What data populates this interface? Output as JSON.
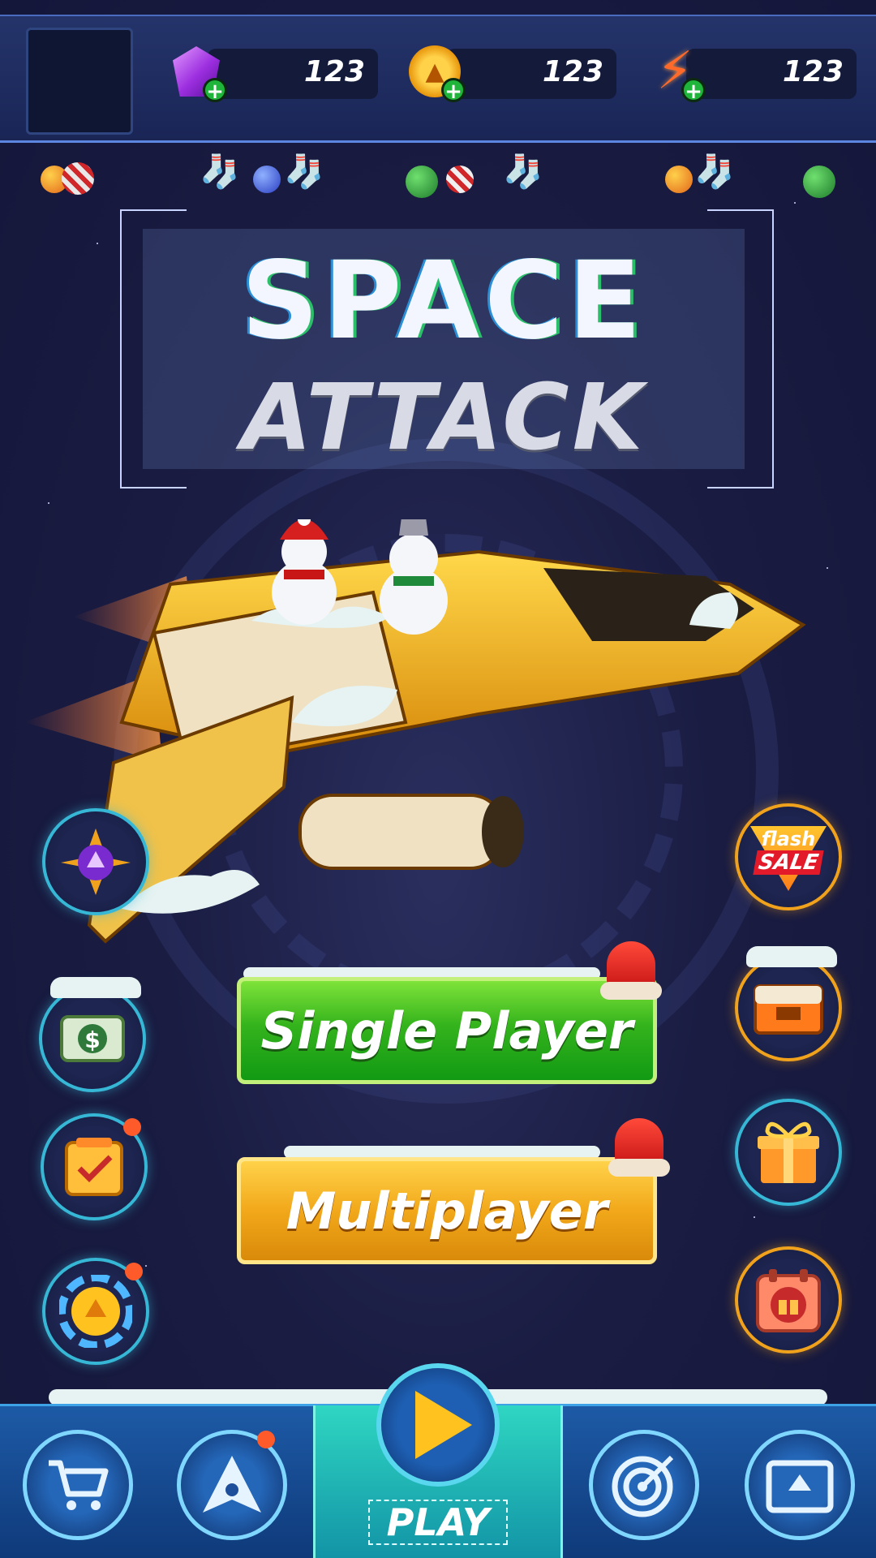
{
  "title": {
    "line1": "SPACE",
    "line2": "ATTACK"
  },
  "resources": [
    {
      "name": "gems",
      "icon": "gem-icon",
      "value": "123"
    },
    {
      "name": "coins",
      "icon": "coin-icon",
      "value": "123"
    },
    {
      "name": "energy",
      "icon": "lightning-icon",
      "value": "123"
    }
  ],
  "buttons": {
    "single": "Single Player",
    "multi": "Multiplayer"
  },
  "flash_sale": {
    "line1": "flash",
    "line2": "SALE"
  },
  "bottom_nav": {
    "play_label": "PLAY"
  },
  "colors": {
    "single_green": "#34b31c",
    "multi_gold": "#f2a81a",
    "nav_blue": "#1d5aa6",
    "play_teal": "#2fd6c2"
  }
}
